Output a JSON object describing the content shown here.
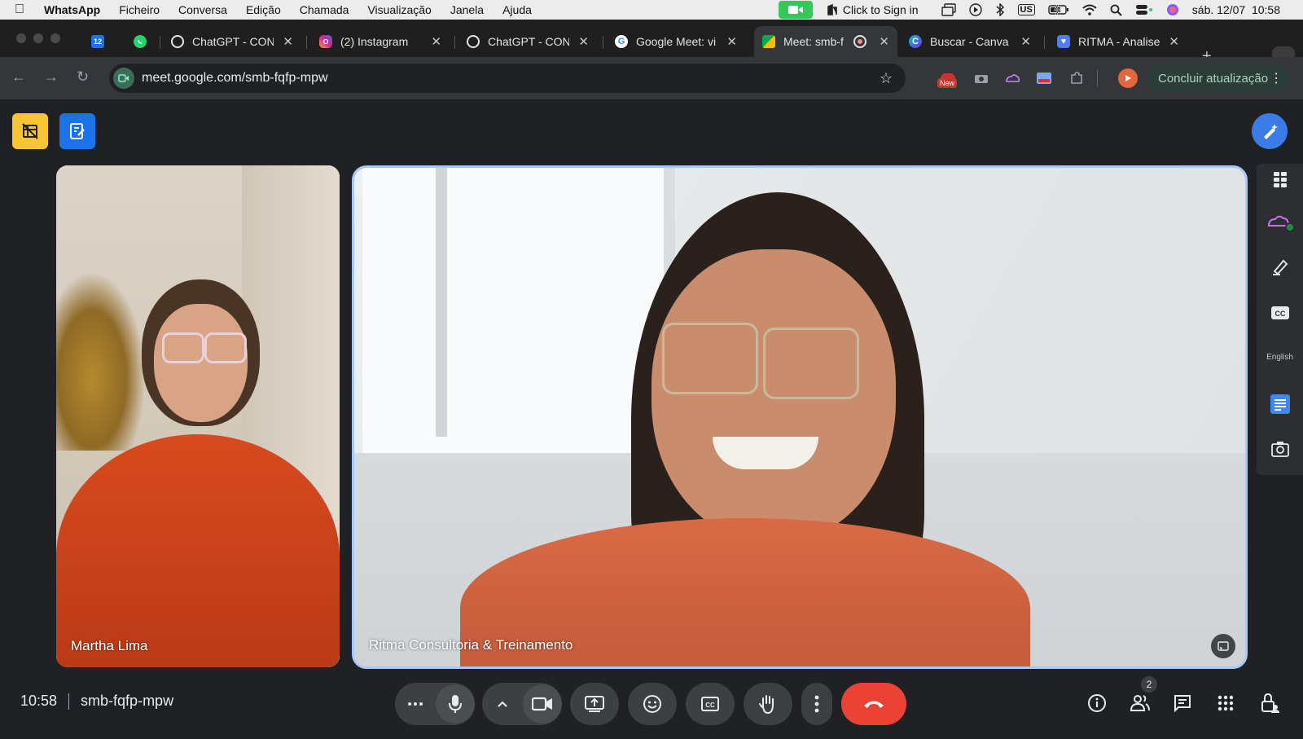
{
  "menubar": {
    "app": "WhatsApp",
    "items": [
      "Ficheiro",
      "Conversa",
      "Edição",
      "Chamada",
      "Visualização",
      "Janela",
      "Ajuda"
    ],
    "sign_in": "Click to Sign in",
    "keyboard": "US",
    "datetime": "sáb. 12/07  10:58"
  },
  "tabs": [
    {
      "title": "",
      "icon": "calendar-icon"
    },
    {
      "title": "",
      "icon": "whatsapp-icon"
    },
    {
      "title": "ChatGPT - CON",
      "icon": "chatgpt-icon"
    },
    {
      "title": "(2) Instagram",
      "icon": "instagram-icon"
    },
    {
      "title": "ChatGPT - CON",
      "icon": "chatgpt-icon"
    },
    {
      "title": "Google Meet: vi",
      "icon": "google-icon"
    },
    {
      "title": "Meet: smb-f",
      "icon": "meet-icon",
      "active": true
    },
    {
      "title": "Buscar - Canva",
      "icon": "canva-icon"
    },
    {
      "title": "RITMA - Analise",
      "icon": "ritma-icon"
    }
  ],
  "toolbar": {
    "url": "meet.google.com/smb-fqfp-mpw",
    "update_label": "Concluir atualização",
    "new_badge": "New"
  },
  "meet": {
    "participants": [
      {
        "name": "Martha Lima"
      },
      {
        "name": "Ritma Consultoria & Treinamento"
      }
    ],
    "time": "10:58",
    "meeting_code": "smb-fqfp-mpw",
    "people_count": "2",
    "side_language": "English"
  },
  "colors": {
    "hangup": "#ea4335",
    "active_tile_border": "#a8c7fa",
    "meet_bg": "#202124",
    "facetime": "#34c759"
  }
}
